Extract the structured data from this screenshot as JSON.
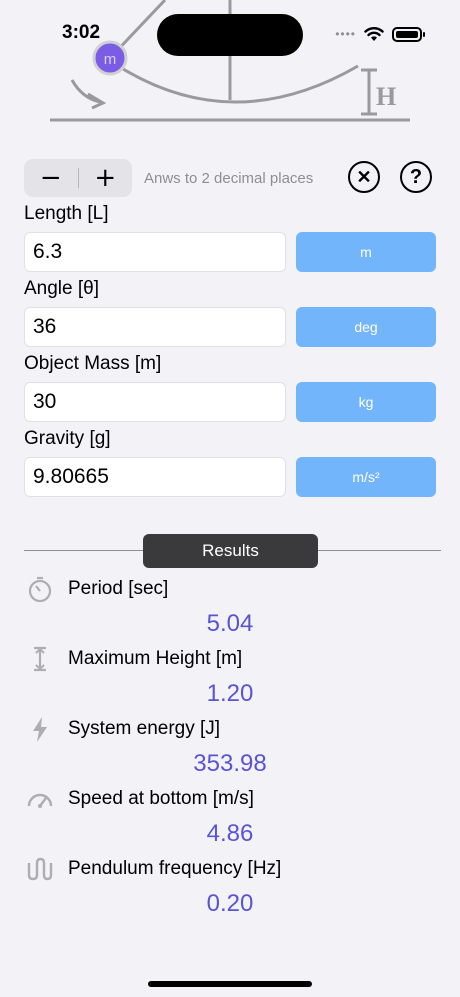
{
  "status_bar": {
    "time": "3:02"
  },
  "diagram": {
    "mass_label": "m",
    "height_label": "H"
  },
  "controls": {
    "minus_label": "−",
    "plus_label": "+",
    "decimal_text": "Anws to 2 decimal places",
    "clear_icon": "✕",
    "help_icon": "?"
  },
  "inputs": [
    {
      "label": "Length [L]",
      "value": "6.3",
      "unit": "m"
    },
    {
      "label": "Angle [θ]",
      "value": "36",
      "unit": "deg"
    },
    {
      "label": "Object Mass [m]",
      "value": "30",
      "unit": "kg"
    },
    {
      "label": "Gravity [g]",
      "value": "9.80665",
      "unit": "m/s²"
    }
  ],
  "results_tab": "Results",
  "results": [
    {
      "label": "Period [sec]",
      "value": "5.04",
      "icon": "stopwatch-icon"
    },
    {
      "label": "Maximum Height [m]",
      "value": "1.20",
      "icon": "height-icon"
    },
    {
      "label": "System energy [J]",
      "value": "353.98",
      "icon": "bolt-icon"
    },
    {
      "label": "Speed at bottom [m/s]",
      "value": "4.86",
      "icon": "speedometer-icon"
    },
    {
      "label": "Pendulum frequency [Hz]",
      "value": "0.20",
      "icon": "wave-icon"
    }
  ],
  "colors": {
    "accent_button": "#73b5fb",
    "result_value": "#5a54d3",
    "mass_ball": "#7b5ce5",
    "background": "#f2f2f7"
  }
}
